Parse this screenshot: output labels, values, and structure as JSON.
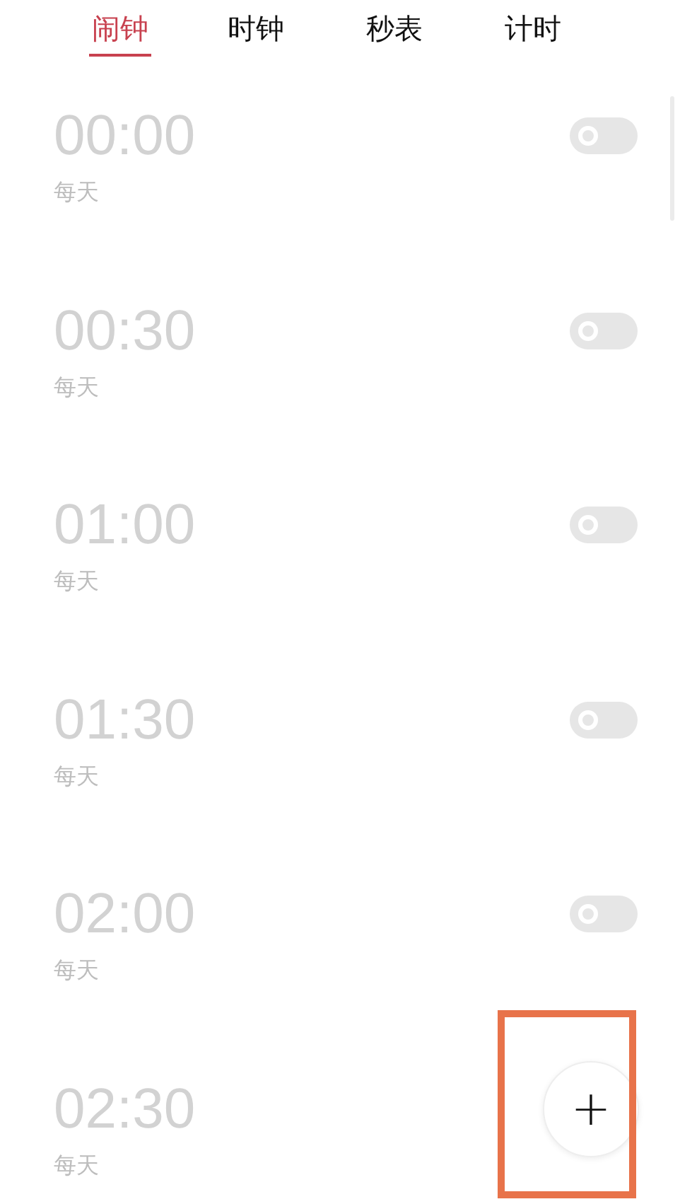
{
  "tabs": [
    {
      "label": "闹钟",
      "selected": true
    },
    {
      "label": "时钟",
      "selected": false
    },
    {
      "label": "秒表",
      "selected": false
    },
    {
      "label": "计时",
      "selected": false
    }
  ],
  "alarms": [
    {
      "time": "00:00",
      "repeat": "每天",
      "on": false
    },
    {
      "time": "00:30",
      "repeat": "每天",
      "on": false
    },
    {
      "time": "01:00",
      "repeat": "每天",
      "on": false
    },
    {
      "time": "01:30",
      "repeat": "每天",
      "on": false
    },
    {
      "time": "02:00",
      "repeat": "每天",
      "on": false
    },
    {
      "time": "02:30",
      "repeat": "每天"
    }
  ],
  "add_button": {
    "label": "+"
  },
  "annotations": [
    {
      "kind": "frame"
    }
  ]
}
